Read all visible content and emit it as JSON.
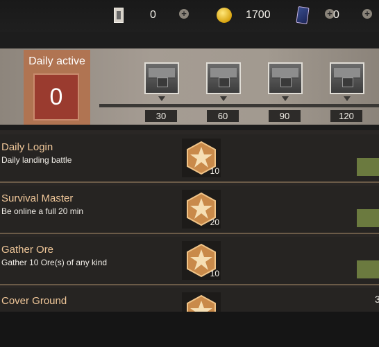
{
  "currencies": [
    {
      "icon": "ticket-icon",
      "value": "0"
    },
    {
      "icon": "gold-coin-icon",
      "value": "1700"
    },
    {
      "icon": "card-icon",
      "value": "0"
    }
  ],
  "daily": {
    "label": "Daily active",
    "value": "0"
  },
  "milestones": [
    "30",
    "60",
    "90",
    "120"
  ],
  "tasks": [
    {
      "title": "Daily Login",
      "desc": "Daily landing battle",
      "reward": "10"
    },
    {
      "title": "Survival Master",
      "desc": "Be online a full 20 min",
      "reward": "20"
    },
    {
      "title": "Gather Ore",
      "desc": "Gather 10 Ore(s) of any kind",
      "reward": "10"
    },
    {
      "title": "Cover Ground",
      "desc": "",
      "reward": ""
    }
  ],
  "partial_progress": "3",
  "colors": {
    "accent": "#b07452",
    "title_text": "#f1c89a",
    "claim_button": "#6b7a3f"
  }
}
